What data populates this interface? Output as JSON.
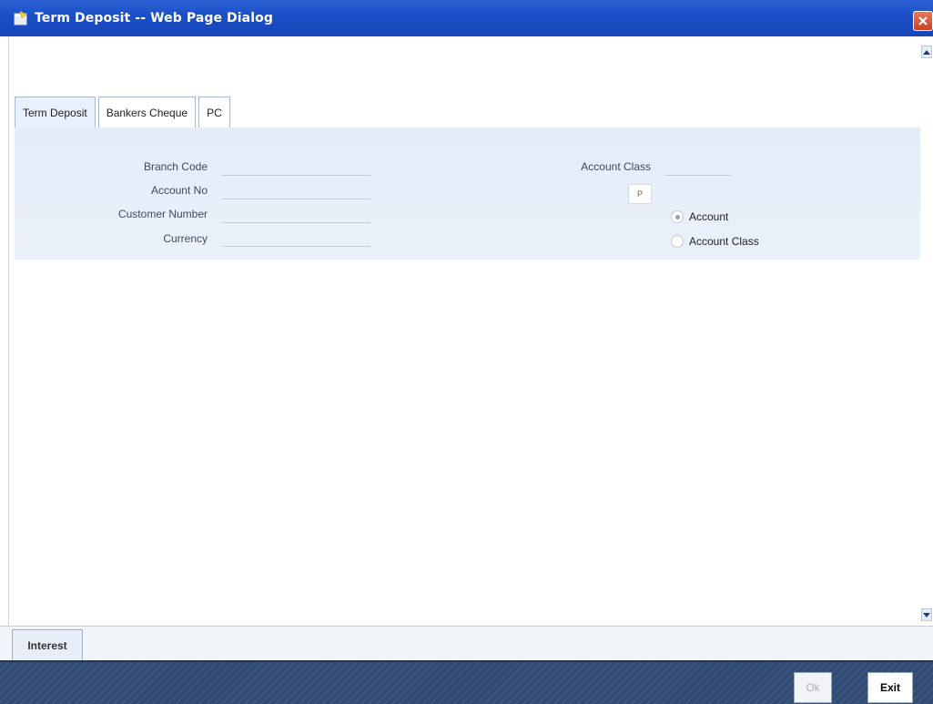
{
  "window": {
    "title": "Term Deposit -- Web Page Dialog"
  },
  "tabs": [
    {
      "label": "Term Deposit",
      "active": true
    },
    {
      "label": "Bankers Cheque",
      "active": false
    },
    {
      "label": "PC",
      "active": false
    }
  ],
  "form": {
    "branch_code_label": "Branch Code",
    "account_no_label": "Account No",
    "customer_number_label": "Customer Number",
    "currency_label": "Currency",
    "account_class_label": "Account Class",
    "lookup_button_label": "P",
    "radio_account_label": "Account",
    "radio_account_class_label": "Account Class",
    "selected_radio": "Account"
  },
  "bottom_tabs": {
    "interest_label": "Interest"
  },
  "footer": {
    "ok_label": "Ok",
    "exit_label": "Exit"
  },
  "colors": {
    "titlebar": "#1b4fc7",
    "panel": "#e3ecf8",
    "footer": "#2f4a73"
  }
}
